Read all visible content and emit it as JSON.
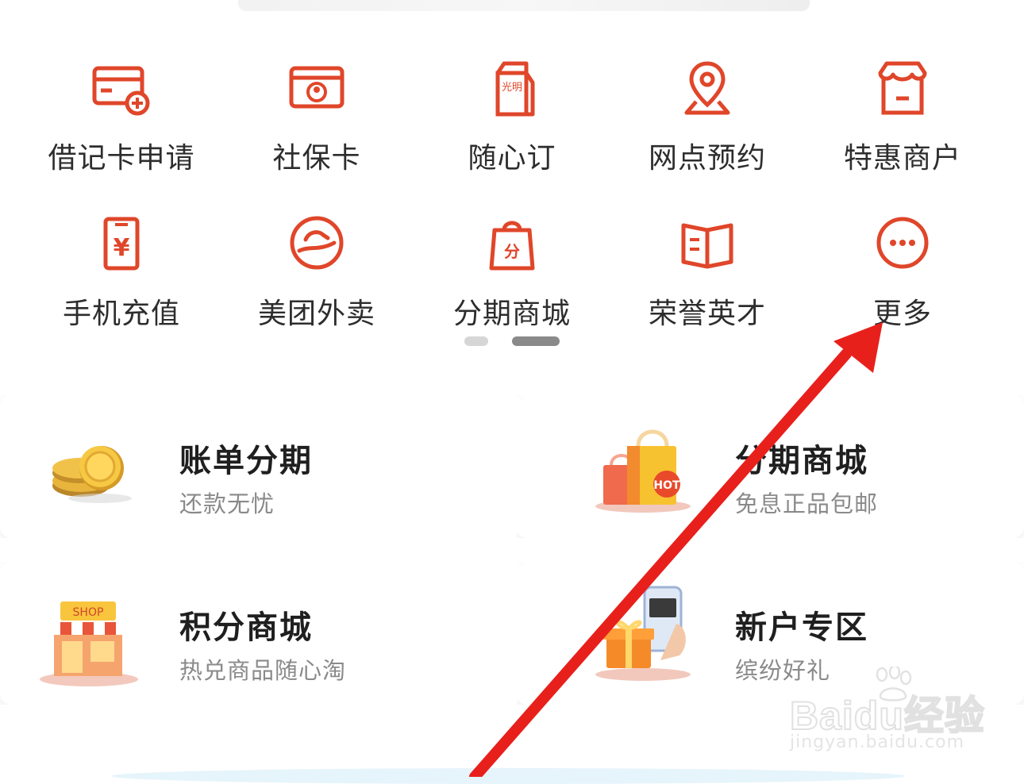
{
  "colors": {
    "accent": "#E0462A",
    "text": "#2d2d2d",
    "subtext": "#8a8a8a",
    "arrow": "#E8201C"
  },
  "services": [
    {
      "label": "借记卡申请",
      "icon": "debit-card-add-icon"
    },
    {
      "label": "社保卡",
      "icon": "social-security-card-icon"
    },
    {
      "label": "随心订",
      "icon": "milk-carton-icon",
      "icon_text": "光明"
    },
    {
      "label": "网点预约",
      "icon": "location-pin-icon"
    },
    {
      "label": "特惠商户",
      "icon": "storefront-icon"
    },
    {
      "label": "手机充值",
      "icon": "phone-recharge-icon",
      "icon_text": "¥"
    },
    {
      "label": "美团外卖",
      "icon": "meituan-icon"
    },
    {
      "label": "分期商城",
      "icon": "shopping-bag-icon",
      "icon_text": "分"
    },
    {
      "label": "荣誉英才",
      "icon": "open-book-icon"
    },
    {
      "label": "更多",
      "icon": "more-dots-icon"
    }
  ],
  "pager": {
    "pages": 2,
    "active": 2
  },
  "promos": [
    {
      "title": "账单分期",
      "subtitle": "还款无忧",
      "icon": "gold-coins-icon"
    },
    {
      "title": "分期商城",
      "subtitle": "免息正品包邮",
      "icon": "hot-shopping-bags-icon",
      "badge": "HOT"
    },
    {
      "title": "积分商城",
      "subtitle": "热兑商品随心淘",
      "icon": "shop-building-icon",
      "badge": "SHOP"
    },
    {
      "title": "新户专区",
      "subtitle": "缤纷好礼",
      "icon": "phone-gift-icon"
    }
  ],
  "watermark": {
    "logo": "Baidu经验",
    "url": "jingyan.baidu.com"
  }
}
